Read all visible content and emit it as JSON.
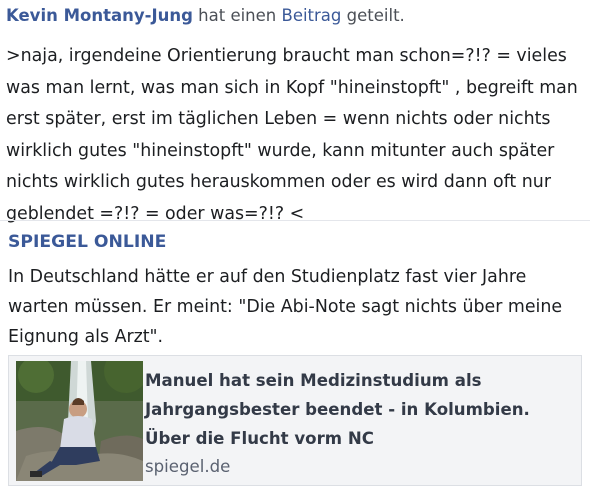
{
  "header": {
    "author": "Kevin Montany-Jung",
    "verb": "hat einen",
    "post_link": "Beitrag",
    "action": "geteilt."
  },
  "post": {
    "text": ">naja, irgendeine Orientierung braucht man schon=?!? = vieles was man lernt, was man sich in Kopf \"hineinstopft\" , begreift man erst später, erst im täglichen Leben = wenn nichts oder nichts wirklich gutes \"hineinstopft\" wurde, kann mitunter auch später nichts wirklich gutes herauskommen oder es wird dann oft nur geblendet =?!? = oder was=?!? <"
  },
  "shared": {
    "source": "SPIEGEL ONLINE",
    "teaser": "In Deutschland hätte er auf den Studienplatz fast vier Jahre warten müssen. Er meint: \"Die Abi-Note sagt nichts über meine Eignung als Arzt\".",
    "card": {
      "title": "Manuel hat sein Medizinstudium als Jahrgangsbester beendet - in Kolumbien. Über die Flucht vorm NC",
      "domain": "spiegel.de",
      "thumbnail": "man-seated-on-rocks-near-waterfall-photo"
    }
  },
  "colors": {
    "link": "#3b5998",
    "text": "#1c1e21",
    "card_bg": "#f3f4f6"
  }
}
